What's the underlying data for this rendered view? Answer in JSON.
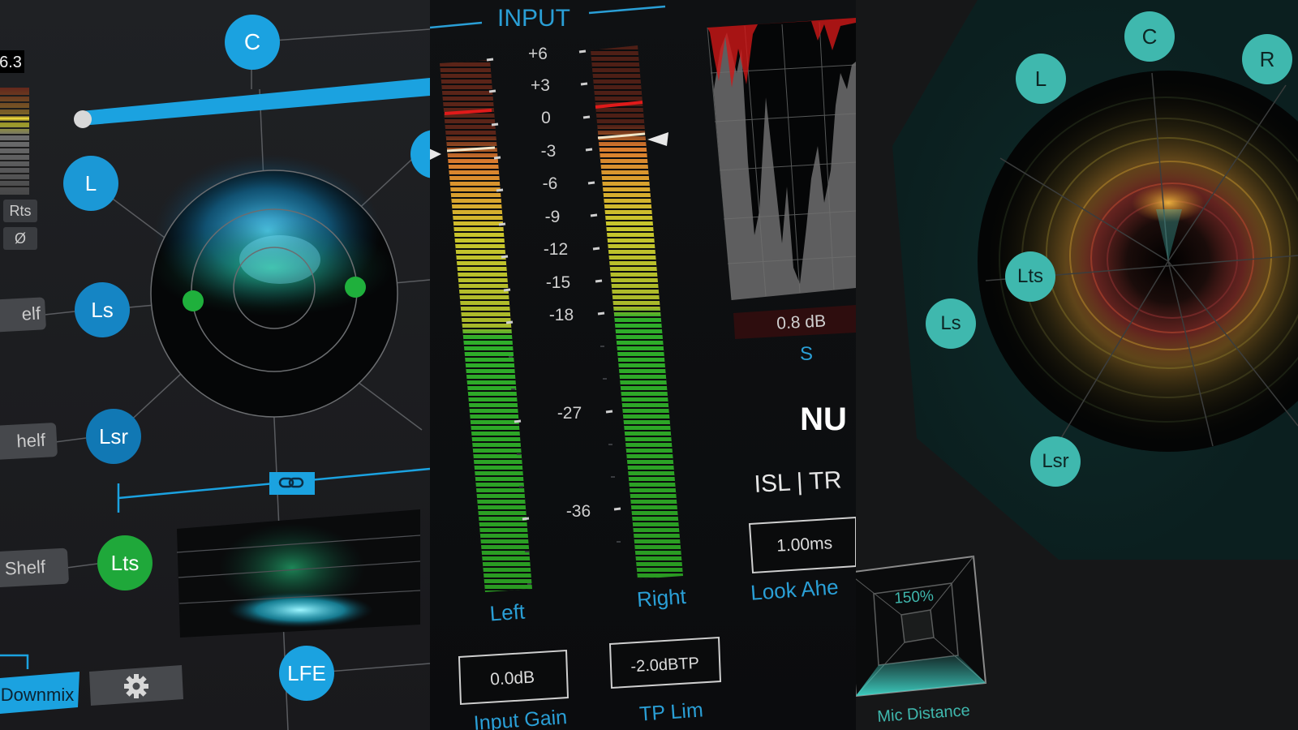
{
  "left_panel": {
    "top_readout": "6.3",
    "meter_buttons": [
      "Rts",
      "Ø"
    ],
    "speakers": [
      "C",
      "L",
      "Ls",
      "Lsr",
      "Lts",
      "LFE"
    ],
    "shelf_buttons": [
      "elf",
      "helf",
      "Shelf"
    ],
    "downmix_label": "Downmix",
    "link_icon": "link-icon",
    "settings_icon": "gear-icon"
  },
  "input_panel": {
    "title": "INPUT",
    "scale": [
      "+6",
      "+3",
      "0",
      "-3",
      "-6",
      "-9",
      "-12",
      "-15",
      "-18",
      "-27",
      "-36"
    ],
    "left_label": "Left",
    "right_label": "Right",
    "input_gain_value": "0.0dB",
    "input_gain_label": "Input Gain",
    "tp_lim_value": "-2.0dBTP",
    "tp_lim_label": "TP Lim",
    "reduction_value": "0.8 dB",
    "reduction_unit": "S",
    "big_label": "NU",
    "isl_label": "ISL | TR",
    "look_ahead_value": "1.00ms",
    "look_ahead_label": "Look Ahe"
  },
  "right_panel": {
    "speakers": [
      "C",
      "L",
      "R",
      "Lts",
      "Ls",
      "Lsr"
    ],
    "mic_distance_value": "150%",
    "mic_distance_label": "Mic Distance"
  },
  "colors": {
    "blue_accent": "#1ba2e0",
    "green_speaker": "#1fa83a",
    "teal_speaker": "#3fb8ae",
    "meter_green": "#2fae2a",
    "meter_yellow": "#c9c62c",
    "meter_orange": "#d97a2e",
    "meter_red": "#d11a1a",
    "label_blue": "#2a9fd6"
  }
}
